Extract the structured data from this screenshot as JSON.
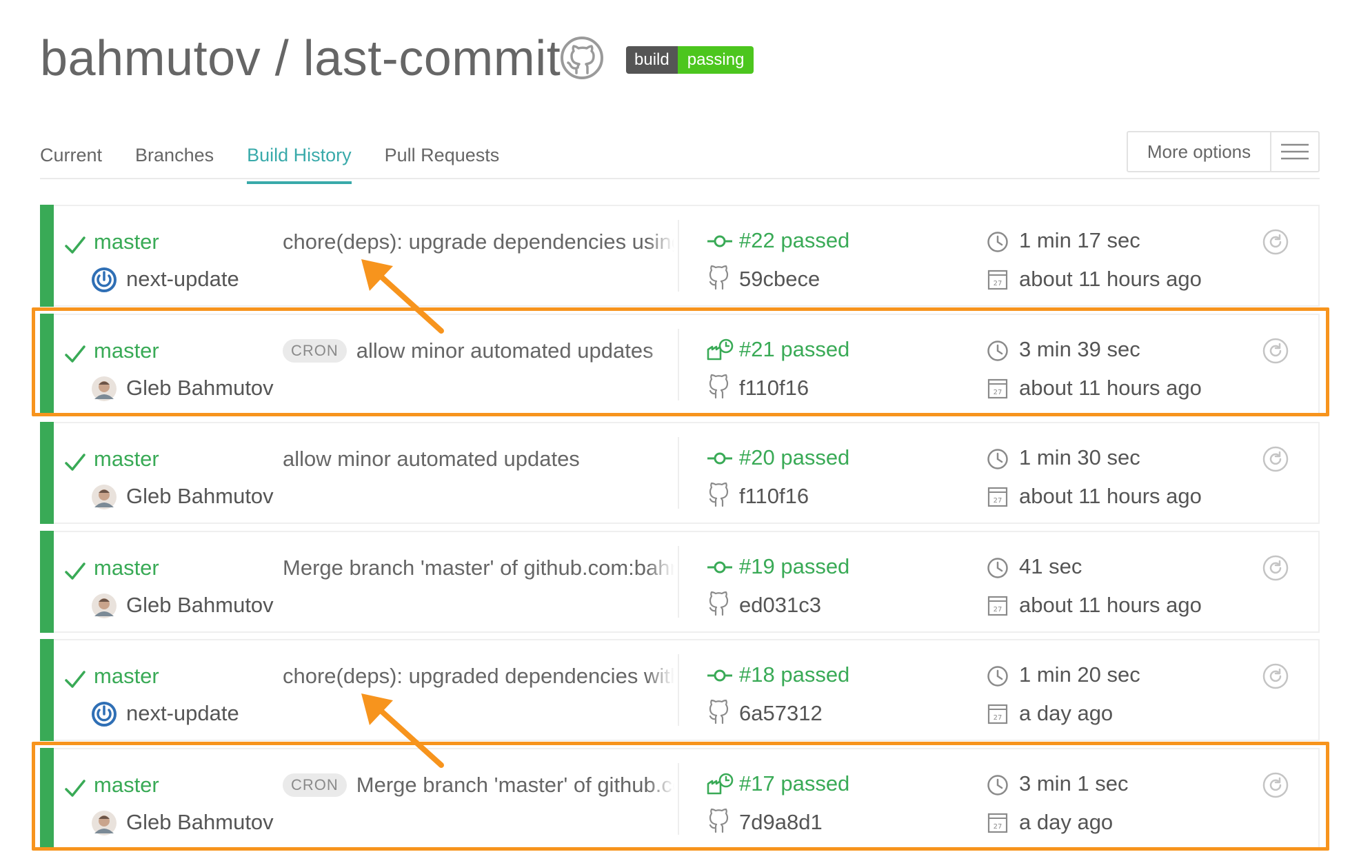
{
  "header": {
    "owner": "bahmutov",
    "separator": " / ",
    "repo": "last-commit",
    "badge_left": "build",
    "badge_right": "passing"
  },
  "tabs": [
    {
      "label": "Current",
      "active": false
    },
    {
      "label": "Branches",
      "active": false
    },
    {
      "label": "Build History",
      "active": true
    },
    {
      "label": "Pull Requests",
      "active": false
    }
  ],
  "more_options": {
    "label": "More options",
    "icon": "hamburger-icon"
  },
  "colors": {
    "passed": "#39aa56",
    "active_tab": "#39aaaa",
    "highlight": "#f7941d",
    "badge_left": "#555555",
    "badge_right": "#4cc61e"
  },
  "builds": [
    {
      "branch": "master",
      "author": "next-update",
      "author_type": "bot",
      "cron": false,
      "cron_label": "",
      "message": "chore(deps): upgrade dependencies using next-update",
      "build": "#22 passed",
      "build_icon": "push-commit-icon",
      "commit": "59cbece",
      "duration": "1 min 17 sec",
      "finished": "about 11 hours ago"
    },
    {
      "branch": "master",
      "author": "Gleb Bahmutov",
      "author_type": "user",
      "cron": true,
      "cron_label": "CRON",
      "message": "allow minor automated updates",
      "build": "#21 passed",
      "build_icon": "cron-icon",
      "commit": "f110f16",
      "duration": "3 min 39 sec",
      "finished": "about 11 hours ago"
    },
    {
      "branch": "master",
      "author": "Gleb Bahmutov",
      "author_type": "user",
      "cron": false,
      "cron_label": "",
      "message": "allow minor automated updates",
      "build": "#20 passed",
      "build_icon": "push-commit-icon",
      "commit": "f110f16",
      "duration": "1 min 30 sec",
      "finished": "about 11 hours ago"
    },
    {
      "branch": "master",
      "author": "Gleb Bahmutov",
      "author_type": "user",
      "cron": false,
      "cron_label": "",
      "message": "Merge branch 'master' of github.com:bahmutov/last-commit",
      "build": "#19 passed",
      "build_icon": "push-commit-icon",
      "commit": "ed031c3",
      "duration": "41 sec",
      "finished": "about 11 hours ago"
    },
    {
      "branch": "master",
      "author": "next-update",
      "author_type": "bot",
      "cron": false,
      "cron_label": "",
      "message": "chore(deps): upgraded dependencies with next-update",
      "build": "#18 passed",
      "build_icon": "push-commit-icon",
      "commit": "6a57312",
      "duration": "1 min 20 sec",
      "finished": "a day ago"
    },
    {
      "branch": "master",
      "author": "Gleb Bahmutov",
      "author_type": "user",
      "cron": true,
      "cron_label": "CRON",
      "message": "Merge branch 'master' of github.com:bahmutov/last-commit",
      "build": "#17 passed",
      "build_icon": "cron-icon",
      "commit": "7d9a8d1",
      "duration": "3 min 1 sec",
      "finished": "a day ago"
    }
  ]
}
